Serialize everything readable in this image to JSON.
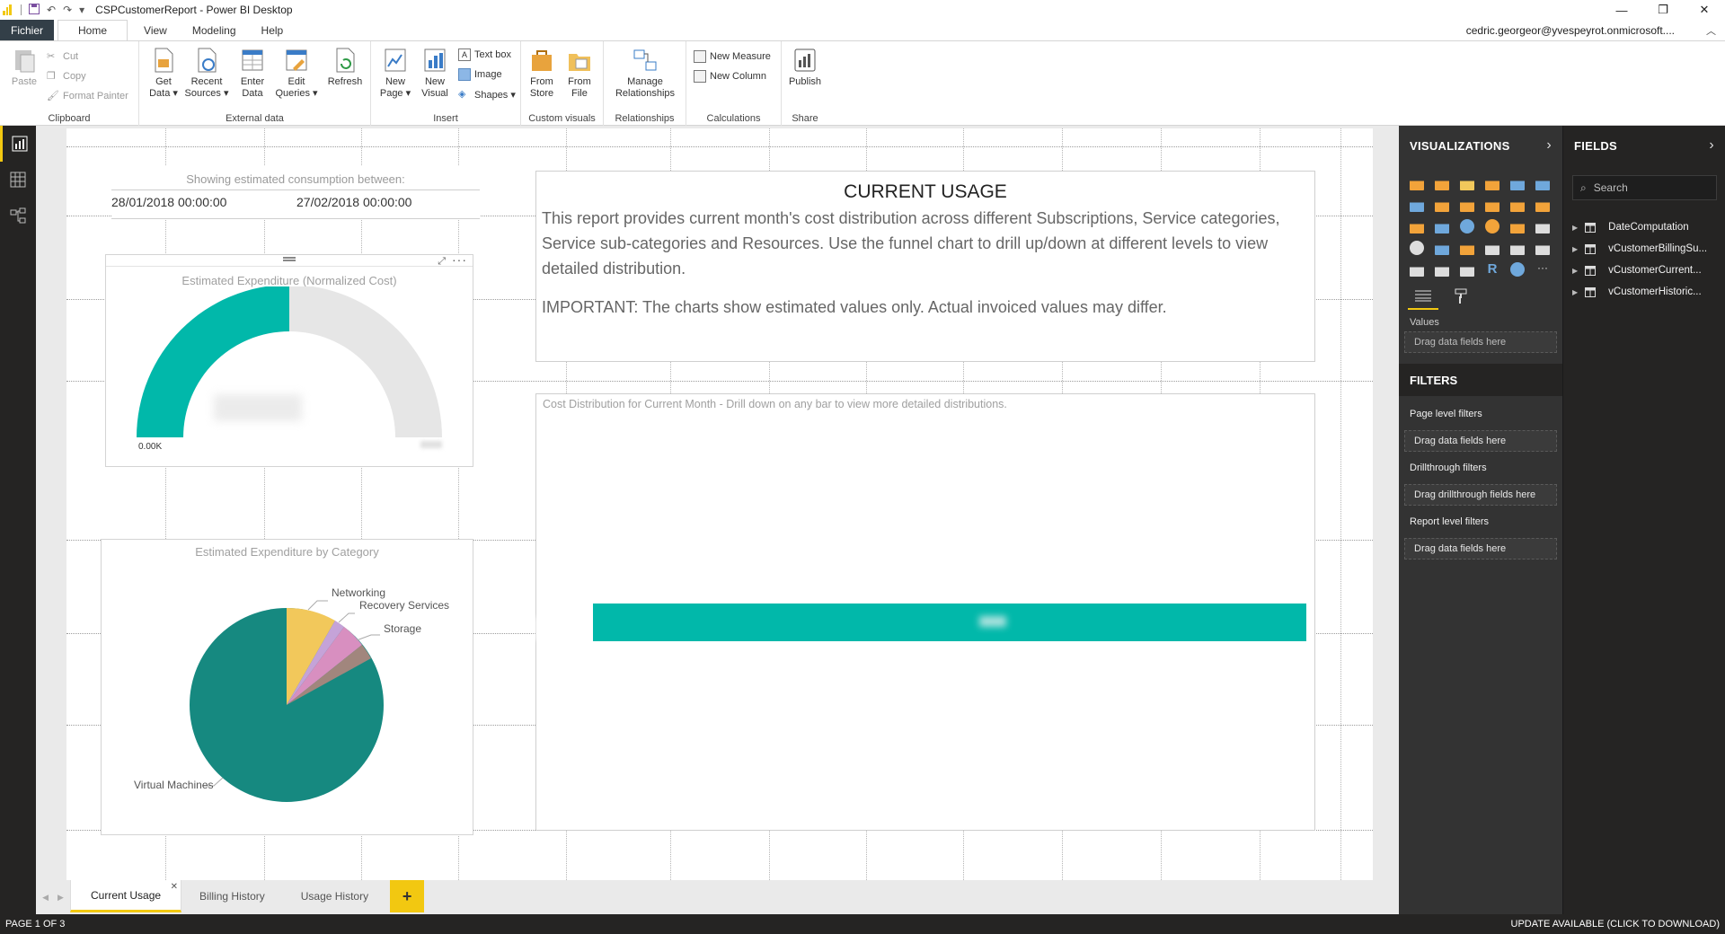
{
  "window": {
    "title": "CSPCustomerReport - Power BI Desktop",
    "user": "cedric.georgeor@yvespeyrot.onmicrosoft....",
    "controls": [
      "—",
      "❐",
      "✕"
    ]
  },
  "ribbon_tabs": [
    "Fichier",
    "Home",
    "View",
    "Modeling",
    "Help"
  ],
  "ribbon": {
    "clipboard": {
      "paste": "Paste",
      "cut": "Cut",
      "copy": "Copy",
      "format_painter": "Format Painter",
      "label": "Clipboard"
    },
    "external": {
      "get_data": "Get\nData ▾",
      "recent_sources": "Recent\nSources ▾",
      "enter_data": "Enter\nData",
      "edit_queries": "Edit\nQueries ▾",
      "refresh": "Refresh",
      "label": "External data"
    },
    "insert": {
      "new_page": "New\nPage ▾",
      "new_visual": "New\nVisual",
      "text_box": "Text box",
      "image": "Image",
      "shapes": "Shapes ▾",
      "label": "Insert"
    },
    "custom_visuals": {
      "from_store": "From\nStore",
      "from_file": "From\nFile",
      "label": "Custom visuals"
    },
    "relationships": {
      "manage": "Manage\nRelationships",
      "label": "Relationships"
    },
    "calculations": {
      "new_measure": "New Measure",
      "new_column": "New Column",
      "label": "Calculations"
    },
    "share": {
      "publish": "Publish",
      "label": "Share"
    }
  },
  "report": {
    "slicer": {
      "header": "Showing estimated consumption between:",
      "start": "28/01/2018 00:00:00",
      "end": "27/02/2018 00:00:00"
    },
    "gauge": {
      "title": "Estimated Expenditure (Normalized Cost)",
      "min_label": "0.00K",
      "fill_fraction": 0.5,
      "colors": {
        "fill": "#01b8aa",
        "track": "#e6e6e6"
      }
    },
    "pie": {
      "title": "Estimated Expenditure by Category",
      "labels": {
        "networking": "Networking",
        "recovery": "Recovery Services",
        "storage": "Storage",
        "vms": "Virtual Machines"
      },
      "colors": {
        "vms": "#168980",
        "networking": "#f2c85b",
        "recovery": "#c5a3d8",
        "storage": "#a1867d"
      }
    },
    "textbox": {
      "heading": "CURRENT USAGE",
      "para1": "This report provides current month's cost distribution across different Subscriptions, Service categories, Service sub-categories and Resources. Use the funnel chart to drill up/down at different levels to view detailed distribution.",
      "para2": "IMPORTANT: The charts show estimated values only. Actual invoiced values may differ."
    },
    "bar_chart": {
      "title": "Cost Distribution for Current Month - Drill down on any bar to view more detailed distributions.",
      "bar_color": "#01b8aa"
    }
  },
  "page_tabs": {
    "tabs": [
      "Current Usage",
      "Billing History",
      "Usage History"
    ],
    "active": "Current Usage",
    "add": "+"
  },
  "status": {
    "page": "PAGE 1 OF 3",
    "update": "UPDATE AVAILABLE (CLICK TO DOWNLOAD)"
  },
  "visualizations": {
    "header": "VISUALIZATIONS",
    "values_label": "Values",
    "drop_values": "Drag data fields here"
  },
  "filters": {
    "header": "FILTERS",
    "page_level": "Page level filters",
    "page_drop": "Drag data fields here",
    "drillthrough": "Drillthrough filters",
    "drillthrough_drop": "Drag drillthrough fields here",
    "report_level": "Report level filters",
    "report_drop": "Drag data fields here"
  },
  "fields": {
    "header": "FIELDS",
    "search_placeholder": "Search",
    "tables": [
      "DateComputation",
      "vCustomerBillingSu...",
      "vCustomerCurrent...",
      "vCustomerHistoric..."
    ]
  }
}
